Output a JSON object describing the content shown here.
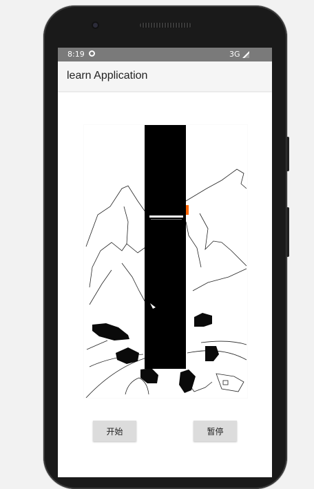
{
  "status_bar": {
    "time": "8:19",
    "network": "3G",
    "icons": [
      "app-notification-icon",
      "signal-icon"
    ]
  },
  "app_bar": {
    "title": "learn Application"
  },
  "game_canvas": {
    "background_color": "#ffffff",
    "tower_color": "#000000",
    "marker_color": "#ff6600"
  },
  "controls": {
    "start_label": "开始",
    "pause_label": "暂停"
  }
}
